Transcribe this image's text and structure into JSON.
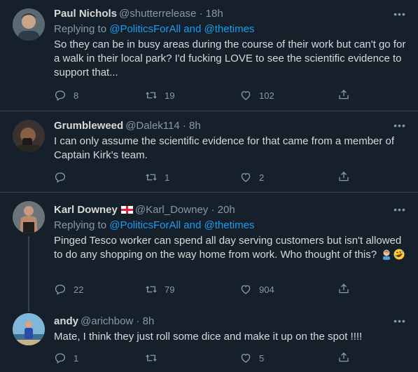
{
  "tweets": [
    {
      "name": "Paul Nichols",
      "handle": "@shutterrelease",
      "time": "18h",
      "replying_prefix": "Replying to ",
      "replying_1": "@PoliticsForAll",
      "replying_and": " and ",
      "replying_2": "@thetimes",
      "text": "So they can be in busy areas during the course of their work but can't go for a walk in their local park? I'd fucking LOVE to see the scientific evidence to support that...",
      "replies": "8",
      "retweets": "19",
      "likes": "102",
      "avatar_icon": "person-photo"
    },
    {
      "name": "Grumbleweed",
      "handle": "@Dalek114",
      "time": "8h",
      "text": "I can only assume the scientific evidence for that  came from a member of Captain Kirk's team.",
      "replies": "",
      "retweets": "1",
      "likes": "2",
      "avatar_icon": "person-photo"
    },
    {
      "name": "Karl Downey",
      "handle": "@Karl_Downey",
      "time": "20h",
      "flag_icon": "england-flag-icon",
      "replying_prefix": "Replying to ",
      "replying_1": "@PoliticsForAll",
      "replying_and": " and ",
      "replying_2": "@thetimes",
      "text": "Pinged Tesco worker can spend all day serving customers but isn't allowed to do any shopping on the way home from work. Who thought of this?",
      "emoji_icons": [
        "man-facepalming-emoji",
        "rolling-on-floor-laughing-emoji"
      ],
      "replies": "22",
      "retweets": "79",
      "likes": "904",
      "avatar_icon": "person-photo"
    },
    {
      "name": "andy",
      "handle": "@arichbow",
      "time": "8h",
      "text": "Mate, I think they just roll some dice and make it up on the spot !!!!",
      "replies": "1",
      "retweets": "",
      "likes": "5",
      "avatar_icon": "person-photo"
    }
  ],
  "separator": " · ",
  "more_glyph": "•••",
  "colors": {
    "background": "#15202b",
    "text": "#d9d9d9",
    "muted": "#8899a6",
    "link": "#1d9bf0",
    "divider": "#38444d"
  }
}
